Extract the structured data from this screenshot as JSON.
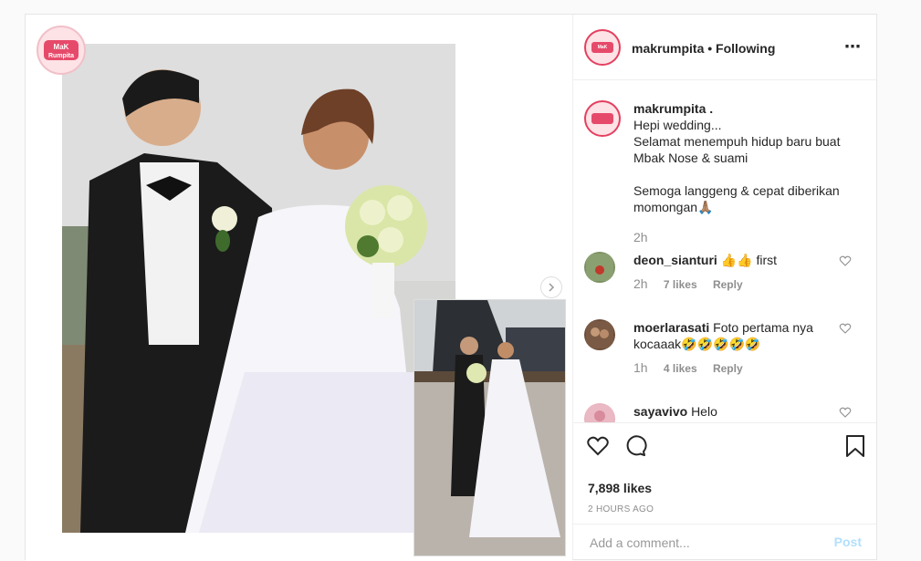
{
  "brand": {
    "logo_text_top": "MaK",
    "logo_text_bottom": "Rumpita",
    "accent": "#e4405f",
    "logo_bg": "#fde2e6"
  },
  "header": {
    "username": "makrumpita",
    "separator": " • ",
    "follow_status": "Following",
    "more_icon": "⋯"
  },
  "caption": {
    "username": "makrumpita .",
    "text": "Hepi wedding...\nSelamat menempuh hidup baru buat Mbak Nose & suami\n\nSemoga langgeng & cepat diberikan momongan🙏🏽",
    "time": "2h"
  },
  "comments": [
    {
      "username": "deon_sianturi",
      "text": "👍👍 first",
      "time": "2h",
      "likes": "7 likes",
      "reply": "Reply"
    },
    {
      "username": "moerlarasati",
      "text": "Foto pertama nya kocaaak🤣🤣🤣🤣🤣",
      "time": "1h",
      "likes": "4 likes",
      "reply": "Reply"
    },
    {
      "username": "sayavivo",
      "text": "Helo"
    }
  ],
  "actions": {
    "likes": "7,898 likes",
    "posted": "2 HOURS AGO"
  },
  "add_comment": {
    "placeholder": "Add a comment...",
    "post_label": "Post"
  }
}
